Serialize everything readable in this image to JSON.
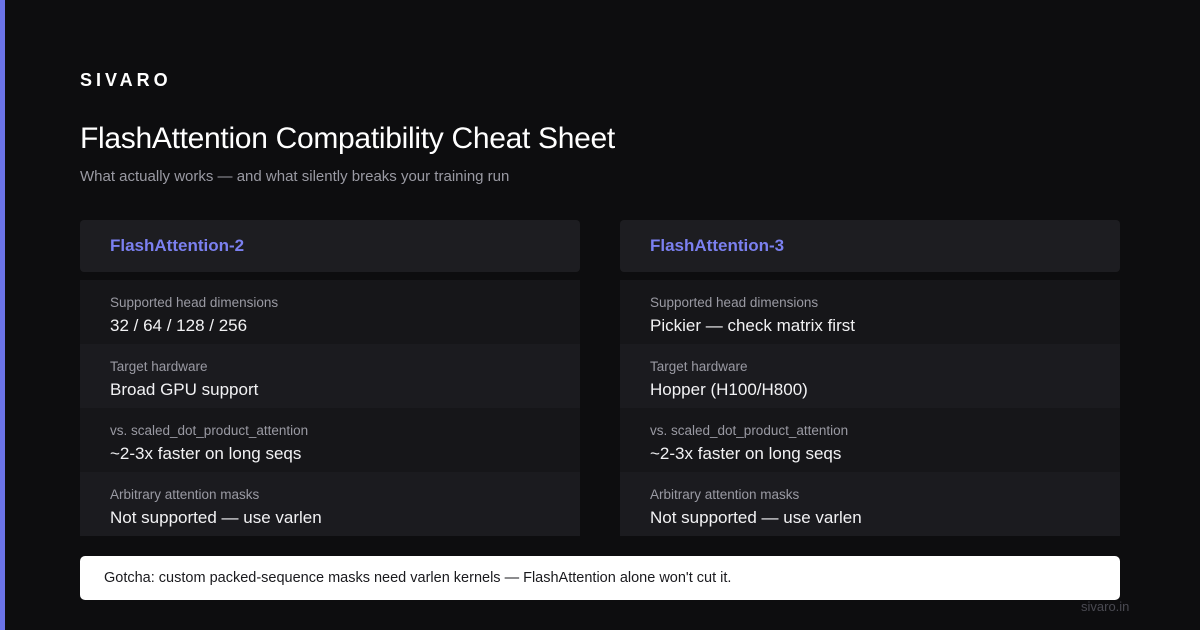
{
  "brand": "SIVARO",
  "title": "FlashAttention Compatibility Cheat Sheet",
  "subtitle": "What actually works — and what silently breaks your training run",
  "accent_color": "#6b73e8",
  "cards": [
    {
      "name": "FlashAttention-2",
      "rows": [
        {
          "label": "Supported head dimensions",
          "value": "32 / 64 / 128 / 256"
        },
        {
          "label": "Target hardware",
          "value": "Broad GPU support"
        },
        {
          "label": "vs. scaled_dot_product_attention",
          "value": "~2-3x faster on long seqs"
        },
        {
          "label": "Arbitrary attention masks",
          "value": "Not supported — use varlen"
        }
      ]
    },
    {
      "name": "FlashAttention-3",
      "rows": [
        {
          "label": "Supported head dimensions",
          "value": "Pickier — check matrix first"
        },
        {
          "label": "Target hardware",
          "value": "Hopper (H100/H800)"
        },
        {
          "label": "vs. scaled_dot_product_attention",
          "value": "~2-3x faster on long seqs"
        },
        {
          "label": "Arbitrary attention masks",
          "value": "Not supported — use varlen"
        }
      ]
    }
  ],
  "gotcha": "Gotcha: custom packed-sequence masks need varlen kernels — FlashAttention alone won't cut it.",
  "domain": "sivaro.in"
}
